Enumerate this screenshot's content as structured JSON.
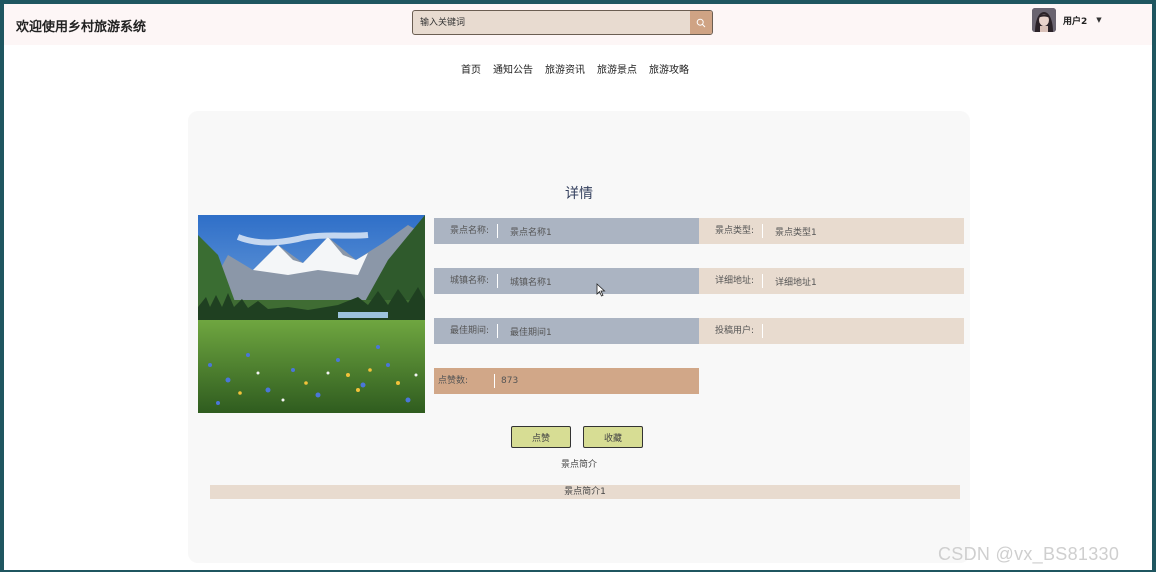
{
  "header": {
    "app_title": "欢迎使用乡村旅游系统",
    "search_placeholder": "输入关键词",
    "search_icon": "search-icon",
    "username": "用户2",
    "user_caret_icon": "caret-down-icon"
  },
  "nav": {
    "items": [
      "首页",
      "通知公告",
      "旅游资讯",
      "旅游景点",
      "旅游攻略"
    ]
  },
  "detail": {
    "title": "详情",
    "image_alt": "mountain-meadow-photo",
    "fields": {
      "name": {
        "label": "景点名称:",
        "value": "景点名称1"
      },
      "type": {
        "label": "景点类型:",
        "value": "景点类型1"
      },
      "town": {
        "label": "城镇名称:",
        "value": "城镇名称1"
      },
      "address": {
        "label": "详细地址:",
        "value": "详细地址1"
      },
      "best_period": {
        "label": "最佳期间:",
        "value": "最佳期间1"
      },
      "poster": {
        "label": "投稿用户:",
        "value": ""
      },
      "likes": {
        "label": "点赞数:",
        "value": "873"
      }
    },
    "like_button": "点赞",
    "favorite_button": "收藏",
    "intro_label": "景点简介",
    "intro_text": "景点简介1"
  },
  "colors": {
    "field_blue": "#abb4c2",
    "field_beige": "#e8dbcf",
    "field_tan": "#d1a788",
    "button_green": "#d7dd94",
    "title_navy": "#34405e"
  },
  "watermark": "CSDN @vx_BS81330"
}
